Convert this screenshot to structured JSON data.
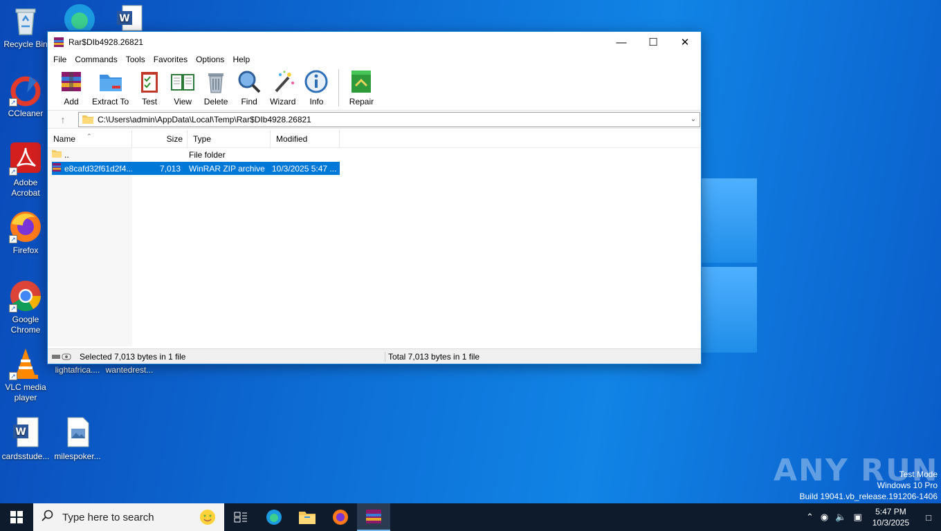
{
  "desktop": {
    "icons": [
      {
        "label": "Recycle Bin"
      },
      {
        "label": "CCleaner"
      },
      {
        "label": "Adobe\nAcrobat"
      },
      {
        "label": "Firefox"
      },
      {
        "label": "Google\nChrome"
      },
      {
        "label": "VLC media\nplayer"
      },
      {
        "label": "lightafrica...."
      },
      {
        "label": "wantedrest..."
      },
      {
        "label": "cardsstude..."
      },
      {
        "label": "milespoker..."
      }
    ]
  },
  "window": {
    "title": "Rar$DIb4928.26821",
    "menu": [
      "File",
      "Commands",
      "Tools",
      "Favorites",
      "Options",
      "Help"
    ],
    "toolbar": [
      {
        "label": "Add",
        "icon": "add-archive-icon"
      },
      {
        "label": "Extract To",
        "icon": "extract-folder-icon"
      },
      {
        "label": "Test",
        "icon": "test-clipboard-icon"
      },
      {
        "label": "View",
        "icon": "view-book-icon"
      },
      {
        "label": "Delete",
        "icon": "trash-icon"
      },
      {
        "label": "Find",
        "icon": "magnifier-icon"
      },
      {
        "label": "Wizard",
        "icon": "wand-icon"
      },
      {
        "label": "Info",
        "icon": "info-icon"
      },
      {
        "label": "Repair",
        "icon": "repair-kit-icon"
      }
    ],
    "address": "C:\\Users\\admin\\AppData\\Local\\Temp\\Rar$DIb4928.26821",
    "columns": [
      "Name",
      "Size",
      "Type",
      "Modified"
    ],
    "rows": [
      {
        "name": "..",
        "size": "",
        "type": "File folder",
        "modified": ""
      },
      {
        "name": "e8cafd32f61d2f4...",
        "size": "7,013",
        "type": "WinRAR ZIP archive",
        "modified": "10/3/2025 5:47 ..."
      }
    ],
    "status_left": "Selected 7,013 bytes in 1 file",
    "status_right": "Total 7,013 bytes in 1 file"
  },
  "taskbar": {
    "search_placeholder": "Type here to search",
    "time": "5:47 PM",
    "date": "10/3/2025"
  },
  "watermark": {
    "line1": "Test Mode",
    "line2": "Windows 10 Pro",
    "line3": "Build 19041.vb_release.191206-1406",
    "brand": "ANY RUN"
  }
}
